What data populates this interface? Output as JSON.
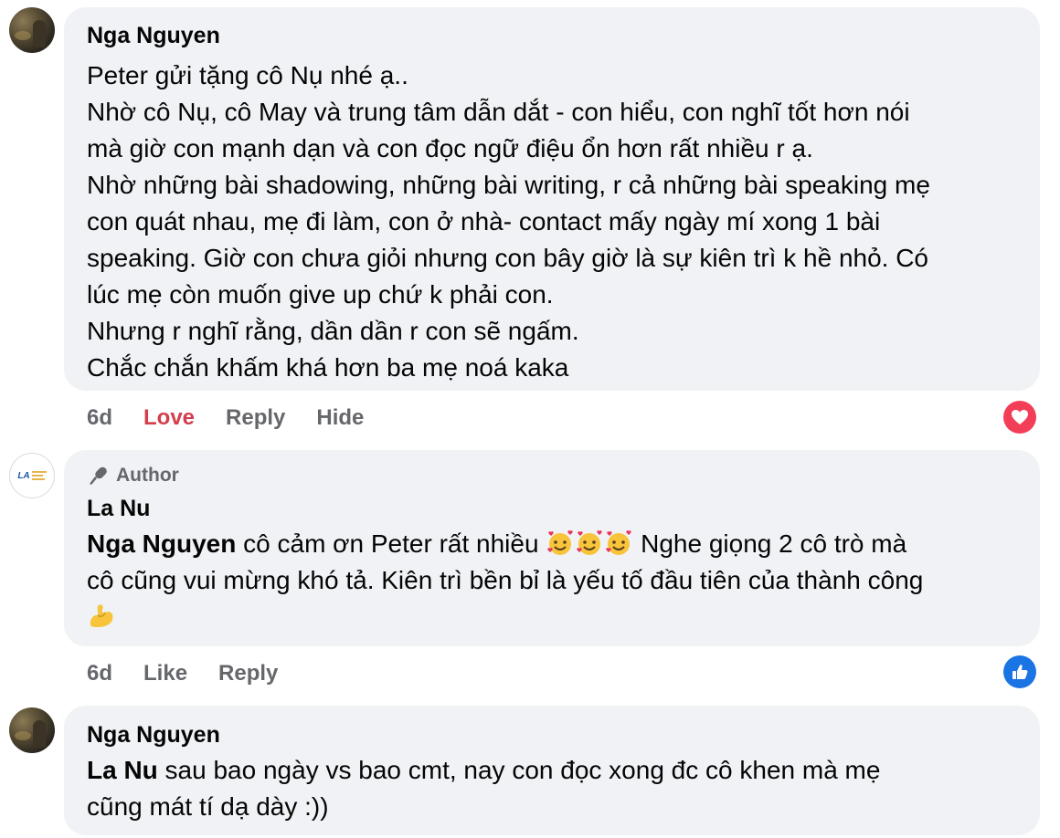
{
  "comments": [
    {
      "author": "Nga Nguyen",
      "lines": [
        "Peter gửi tặng cô Nụ nhé ạ..",
        "Nhờ cô Nụ, cô May và trung tâm dẫn dắt - con hiểu, con nghĩ tốt hơn nói",
        "mà giờ con mạnh dạn và con đọc ngữ điệu ổn hơn rất nhiều r ạ.",
        "Nhờ những bài shadowing, những bài writing, r cả những bài speaking mẹ",
        "con quát nhau, mẹ đi làm, con ở nhà- contact mấy ngày mí xong 1 bài",
        "speaking. Giờ con chưa giỏi nhưng con bây giờ là sự kiên trì k hề nhỏ. Có",
        "lúc mẹ còn muốn give up chứ k phải con.",
        "Nhưng r nghĩ rằng, dần dần r con sẽ ngấm.",
        "Chắc chắn khấm khá hơn ba mẹ noá kaka"
      ],
      "time": "6d",
      "actions": [
        "Love",
        "Reply",
        "Hide"
      ],
      "reaction_icon": "heart-icon"
    },
    {
      "badge": "Author",
      "author": "La Nu",
      "mention": "Nga Nguyen",
      "line1_text": " cô cảm ơn Peter rất nhiều ",
      "line1_after": " Nghe giọng 2 cô trò mà",
      "line2": "cô cũng vui mừng khó tả. Kiên trì bền bỉ là yếu tố đầu tiên của thành công",
      "emojis": [
        "smiling-face-with-hearts-icon",
        "smiling-face-with-hearts-icon",
        "smiling-face-with-hearts-icon",
        "flexed-biceps-icon"
      ],
      "time": "6d",
      "actions": [
        "Like",
        "Reply"
      ],
      "reaction_icon": "thumbs-up-icon"
    },
    {
      "author": "Nga Nguyen",
      "mention": "La Nu",
      "line1_text": " sau bao ngày vs bao cmt, nay con đọc xong đc cô khen mà mẹ",
      "line2": "cũng mát tí dạ dày :))"
    }
  ],
  "colors": {
    "bubble": "#f0f2f5",
    "love": "#d43d4c",
    "like_blue": "#1b74e4",
    "heart_red": "#f33e58",
    "muted": "#65676b"
  }
}
